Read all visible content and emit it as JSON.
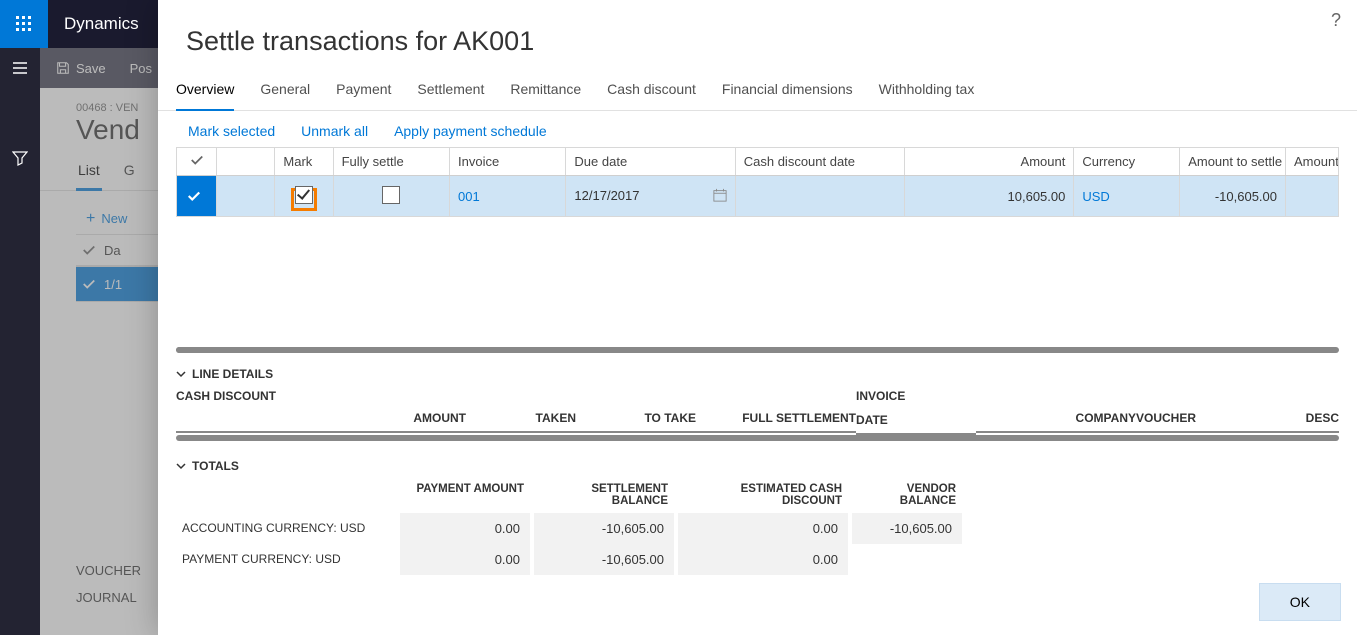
{
  "brand": "Dynamics",
  "cmdbar": {
    "save": "Save",
    "post": "Pos"
  },
  "background": {
    "crumb": "00468 : VEN",
    "title": "Vend",
    "tabs": [
      "List",
      "G"
    ],
    "new": "New",
    "listHeader": "Da",
    "listRow": "1/1",
    "sidelabels": [
      "VOUCHER",
      "JOURNAL"
    ]
  },
  "dialog": {
    "title": "Settle transactions for AK001",
    "tabs": [
      "Overview",
      "General",
      "Payment",
      "Settlement",
      "Remittance",
      "Cash discount",
      "Financial dimensions",
      "Withholding tax"
    ],
    "actions": {
      "markSelected": "Mark selected",
      "unmarkAll": "Unmark all",
      "applySchedule": "Apply payment schedule"
    },
    "grid": {
      "headers": {
        "mark": "Mark",
        "fully": "Fully settle",
        "invoice": "Invoice",
        "due": "Due date",
        "cashDate": "Cash discount date",
        "amount": "Amount",
        "currency": "Currency",
        "amtSettle": "Amount to settle",
        "amt2": "Amount"
      },
      "row": {
        "invoice": "001",
        "due": "12/17/2017",
        "amount": "10,605.00",
        "currency": "USD",
        "amtSettle": "-10,605.00"
      }
    },
    "lineDetails": {
      "title": "LINE DETAILS",
      "cashDiscount": "CASH DISCOUNT",
      "cols": {
        "amount": "AMOUNT",
        "taken": "TAKEN",
        "toTake": "TO TAKE",
        "fullSettlement": "FULL SETTLEMENT",
        "invoiceDate": "INVOICE DATE",
        "company": "COMPANY",
        "voucher": "VOUCHER",
        "desc": "DESC"
      }
    },
    "totals": {
      "title": "TOTALS",
      "headers": {
        "paymentAmount": "PAYMENT AMOUNT",
        "settlementBalance": "SETTLEMENT BALANCE",
        "estDisc": "ESTIMATED CASH DISCOUNT",
        "vendorBalance": "VENDOR BALANCE"
      },
      "rows": [
        {
          "label": "ACCOUNTING CURRENCY: USD",
          "paymentAmount": "0.00",
          "settlementBalance": "-10,605.00",
          "estDisc": "0.00",
          "vendorBalance": "-10,605.00"
        },
        {
          "label": "PAYMENT CURRENCY: USD",
          "paymentAmount": "0.00",
          "settlementBalance": "-10,605.00",
          "estDisc": "0.00",
          "vendorBalance": ""
        }
      ]
    },
    "ok": "OK"
  }
}
